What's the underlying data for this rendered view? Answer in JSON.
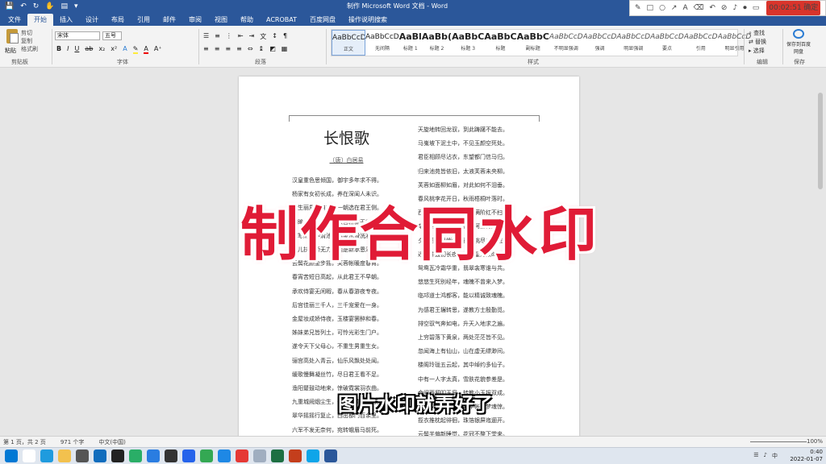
{
  "titlebar": {
    "qat": [
      "save-icon",
      "undo-icon",
      "redo-icon",
      "touch-icon",
      "print-preview-icon",
      "customize-icon"
    ],
    "title": "制作 Microsoft Word 文档 - Word"
  },
  "recorder": {
    "time": "00:02:51",
    "status": "确定"
  },
  "tabs": [
    "文件",
    "开始",
    "插入",
    "设计",
    "布局",
    "引用",
    "邮件",
    "审阅",
    "视图",
    "帮助",
    "ACROBAT",
    "百度网盘",
    "操作说明搜索"
  ],
  "ribbon": {
    "clipboard": {
      "paste": "粘贴",
      "cut": "剪切",
      "copy": "复制",
      "painter": "格式刷",
      "label": "剪贴板"
    },
    "font": {
      "name": "宋体",
      "size": "五号",
      "label": "字体"
    },
    "paragraph": {
      "label": "段落"
    },
    "styles": {
      "label": "样式",
      "items": [
        {
          "preview": "AaBbCcD",
          "name": "正文"
        },
        {
          "preview": "AaBbCcD",
          "name": "无间隔"
        },
        {
          "preview": "AaBl",
          "name": "标题 1"
        },
        {
          "preview": "AaBb(",
          "name": "标题 2"
        },
        {
          "preview": "AaBbC",
          "name": "标题 3"
        },
        {
          "preview": "AaBbC",
          "name": "标题"
        },
        {
          "preview": "AaBbC",
          "name": "副标题"
        },
        {
          "preview": "AaBbCcD",
          "name": "不明显强调"
        },
        {
          "preview": "AaBbCcD",
          "name": "强调"
        },
        {
          "preview": "AaBbCcD",
          "name": "明显强调"
        },
        {
          "preview": "AaBbCcD",
          "name": "要点"
        },
        {
          "preview": "AaBbCcD",
          "name": "引用"
        },
        {
          "preview": "AaBbCcD",
          "name": "明显引用"
        }
      ]
    },
    "editing": {
      "find": "查找",
      "replace": "替换",
      "select": "选择",
      "label": "编辑"
    },
    "save": {
      "label": "保存",
      "button": "保存到百度网盘"
    }
  },
  "document": {
    "title": "长恨歌",
    "author": "〔唐〕白居易",
    "left_lines": [
      "汉皇重色思倾国，御宇多年求不得。",
      "杨家有女初长成，养在深闺人未识。",
      "天生丽质难自弃，一朝选在君王侧。",
      "回眸一笑百媚生，六宫粉黛无颜色。",
      "春寒赐浴华清池，温泉水滑洗凝脂。",
      "侍儿扶起娇无力，始是新承恩泽时。",
      "云鬓花颜金步摇，芙蓉帐暖度春宵。",
      "春宵苦短日高起，从此君王不早朝。",
      "承欢侍宴无闲暇，春从春游夜专夜。",
      "后宫佳丽三千人，三千宠爱在一身。",
      "金屋妆成娇侍夜，玉楼宴罢醉和春。",
      "姊妹弟兄皆列土，可怜光彩生门户。",
      "遂令天下父母心，不重生男重生女。",
      "骊宫高处入青云，仙乐风飘处处闻。",
      "缓歌慢舞凝丝竹，尽日君王看不足。",
      "渔阳鼙鼓动地来，惊破霓裳羽衣曲。",
      "九重城阙烟尘生，千乘万骑西南行。",
      "翠华摇摇行复止，西出都门百余里。",
      "六军不发无奈何，宛转蛾眉马前死。",
      "花钿委地无人收，翠翘金雀玉搔头。"
    ],
    "right_lines": [
      "天旋地转回龙驭，到此踌躇不能去。",
      "马嵬坡下泥土中，不见玉颜空死处。",
      "君臣相顾尽沾衣，东望都门信马归。",
      "归来池苑皆依旧，太液芙蓉未央柳。",
      "芙蓉如面柳如眉，对此如何不泪垂。",
      "春风桃李花开日，秋雨梧桐叶落时。",
      "西宫南内多秋草，落叶满阶红不扫。",
      "梨园弟子白发新，椒房阿监青娥老。",
      "夕殿萤飞思悄然，孤灯挑尽未成眠。",
      "迟迟钟鼓初长夜，耿耿星河欲曙天。",
      "鸳鸯瓦冷霜华重，翡翠衾寒谁与共。",
      "悠悠生死别经年，魂魄不曾来入梦。",
      "临邛道士鸿都客，能以精诚致魂魄。",
      "为感君王辗转思，遂教方士殷勤觅。",
      "排空驭气奔如电，升天入地求之遍。",
      "上穷碧落下黄泉，两处茫茫皆不见。",
      "忽闻海上有仙山，山在虚无缥渺间。",
      "楼阁玲珑五云起，其中绰约多仙子。",
      "中有一人字太真，雪肤花貌参差是。",
      "金阙西厢叩玉扃，转教小玉报双成。",
      "闻道汉家天子使，九华帐里梦魂惊。",
      "揽衣推枕起徘徊，珠箔银屏迤逦开。",
      "云鬓半偏新睡觉，花冠不整下堂来。"
    ]
  },
  "overlay": {
    "title": "制作合同水印",
    "subtitle": "图片水印就弄好了"
  },
  "statusbar": {
    "page": "第 1 页，共 2 页",
    "words": "971 个字",
    "lang": "中文(中国)",
    "zoom": "100%"
  },
  "taskbar": {
    "time": "0:40",
    "date": "2022-01-07",
    "ime": "中",
    "apps": [
      "start-icon",
      "search-icon",
      "edge-icon",
      "explorer-icon",
      "camera-icon",
      "mail-icon",
      "qq-icon",
      "wechat-icon",
      "dingtalk-icon",
      "terminal-icon",
      "store-icon",
      "chrome-icon",
      "security-icon",
      "music-icon",
      "app-icon",
      "excel-icon",
      "ppt-icon",
      "browser-icon",
      "word-icon"
    ],
    "colors": [
      "#0078d4",
      "#ffffff",
      "#1f9bde",
      "#f2c14e",
      "#555555",
      "#0f6cbd",
      "#222222",
      "#2aae67",
      "#2a7de1",
      "#333333",
      "#2563eb",
      "#34a853",
      "#1e88e5",
      "#e53935",
      "#a0aec0",
      "#1d6f42",
      "#c43e1c",
      "#0ea5e9",
      "#2b579a"
    ]
  }
}
